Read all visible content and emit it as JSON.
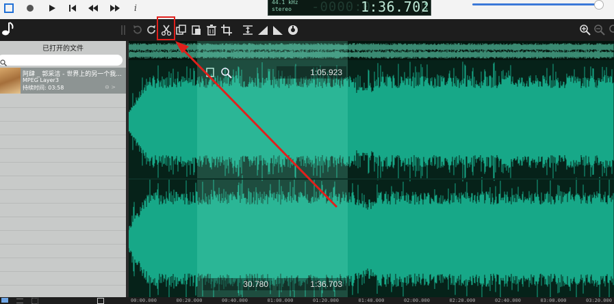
{
  "transport": {
    "buttons": [
      "stop-icon",
      "record-icon",
      "play-icon",
      "skip-back-icon",
      "rewind-icon",
      "fast-forward-icon",
      "info-icon"
    ],
    "info_label": "i"
  },
  "lcd": {
    "sample_rate": "44.1 kHz",
    "channels": "stereo",
    "ghost_digits": "-0000:0",
    "time": "1:36.702"
  },
  "volume": {
    "level_percent": 96
  },
  "toolbar": {
    "tools": [
      "undo-icon",
      "redo-icon",
      "cut-icon",
      "copy-icon",
      "paste-icon",
      "delete-icon",
      "crop-icon",
      "normalize-icon",
      "fade-in-icon",
      "fade-out-icon",
      "effect-icon"
    ],
    "zoom": [
      "zoom-in-icon",
      "zoom-out-icon",
      "zoom-fit-icon"
    ]
  },
  "sidebar": {
    "title": "已打开的文件",
    "search_placeholder": "",
    "file": {
      "title": "阿肆 _ 郭采洁 - 世界上的另一个我...",
      "format": "MPEG Layer3",
      "duration": "持续时间: 03:58"
    }
  },
  "waveform": {
    "selection_start": "30.780",
    "selection_end": "1:36.703",
    "cursor": "1:05.923",
    "colors": {
      "wave": "#17a888",
      "selection": "#3fc1a0",
      "background": "#062219"
    }
  },
  "ruler": {
    "labels": [
      "00:00.000",
      "00:20.000",
      "00:40.000",
      "01:00.000",
      "01:20.000",
      "01:40.000",
      "02:00.000",
      "02:20.000",
      "02:40.000",
      "03:00.000",
      "03:20.000"
    ]
  }
}
